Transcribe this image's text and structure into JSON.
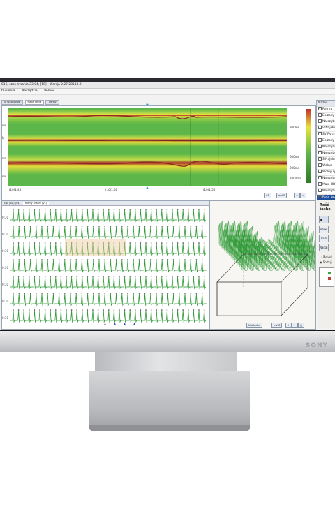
{
  "window": {
    "title": "016, czas trwania 33:04, [18] - Wersja 2.27.28513.0",
    "menu": [
      "tawienia",
      "Narzędzia",
      "Pomoc"
    ]
  },
  "tabs": [
    "la szczegółów",
    "Mapa Serca",
    "Trendy"
  ],
  "trend_panel": {
    "left_labels": [
      "ms",
      "R",
      "ms",
      "ms"
    ],
    "right_labels": [
      "300ms",
      "",
      "600ms",
      "800ms",
      "1000ms"
    ],
    "time_labels": [
      "(10)1:45",
      "(10)1:50",
      "(10)1:55"
    ],
    "toolbar": {
      "af": "AF",
      "zoom": "mV/S"
    }
  },
  "ecg_panel": {
    "tab_labels": [
      "cgii (BD) (V4)",
      "Rytmy zdarzy (V1)"
    ],
    "row_labels": [
      "0:30",
      "0:30",
      "0:30",
      "0:30",
      "0:30",
      "0:30",
      "0:30"
    ]
  },
  "map3d": {
    "toolbar": {
      "mode": "Nakładka",
      "zoom": "mV/S"
    }
  },
  "side_list": {
    "header": "Nazw",
    "items": [
      "Rytmy",
      "Epizody V",
      "Najszybszy",
      "V Najsłu",
      "SV Rytmy",
      "Epizody S",
      "Najszybszy",
      "Najszybszy",
      "S Najsłu",
      "Wolne",
      "Wolny rytm",
      "Najszybszy",
      "Max. HR",
      "Najszybszy",
      "Rość tach"
    ],
    "checked_indices": [
      0
    ]
  },
  "side_panel": {
    "title": "Rość tacho",
    "buttons": [
      "",
      "Pierw",
      "Usuń",
      "Nadaj"
    ],
    "radio_labels": [
      "Sortuj",
      "Sortuj"
    ]
  },
  "brand": {
    "logo": "SONY"
  },
  "colors": {
    "trend_green": "#4cae3b",
    "trend_yellow": "#e6e63c",
    "trend_red": "#b0302a",
    "ecg_green": "#2f9a36",
    "panel_border": "#9ba6b4"
  }
}
